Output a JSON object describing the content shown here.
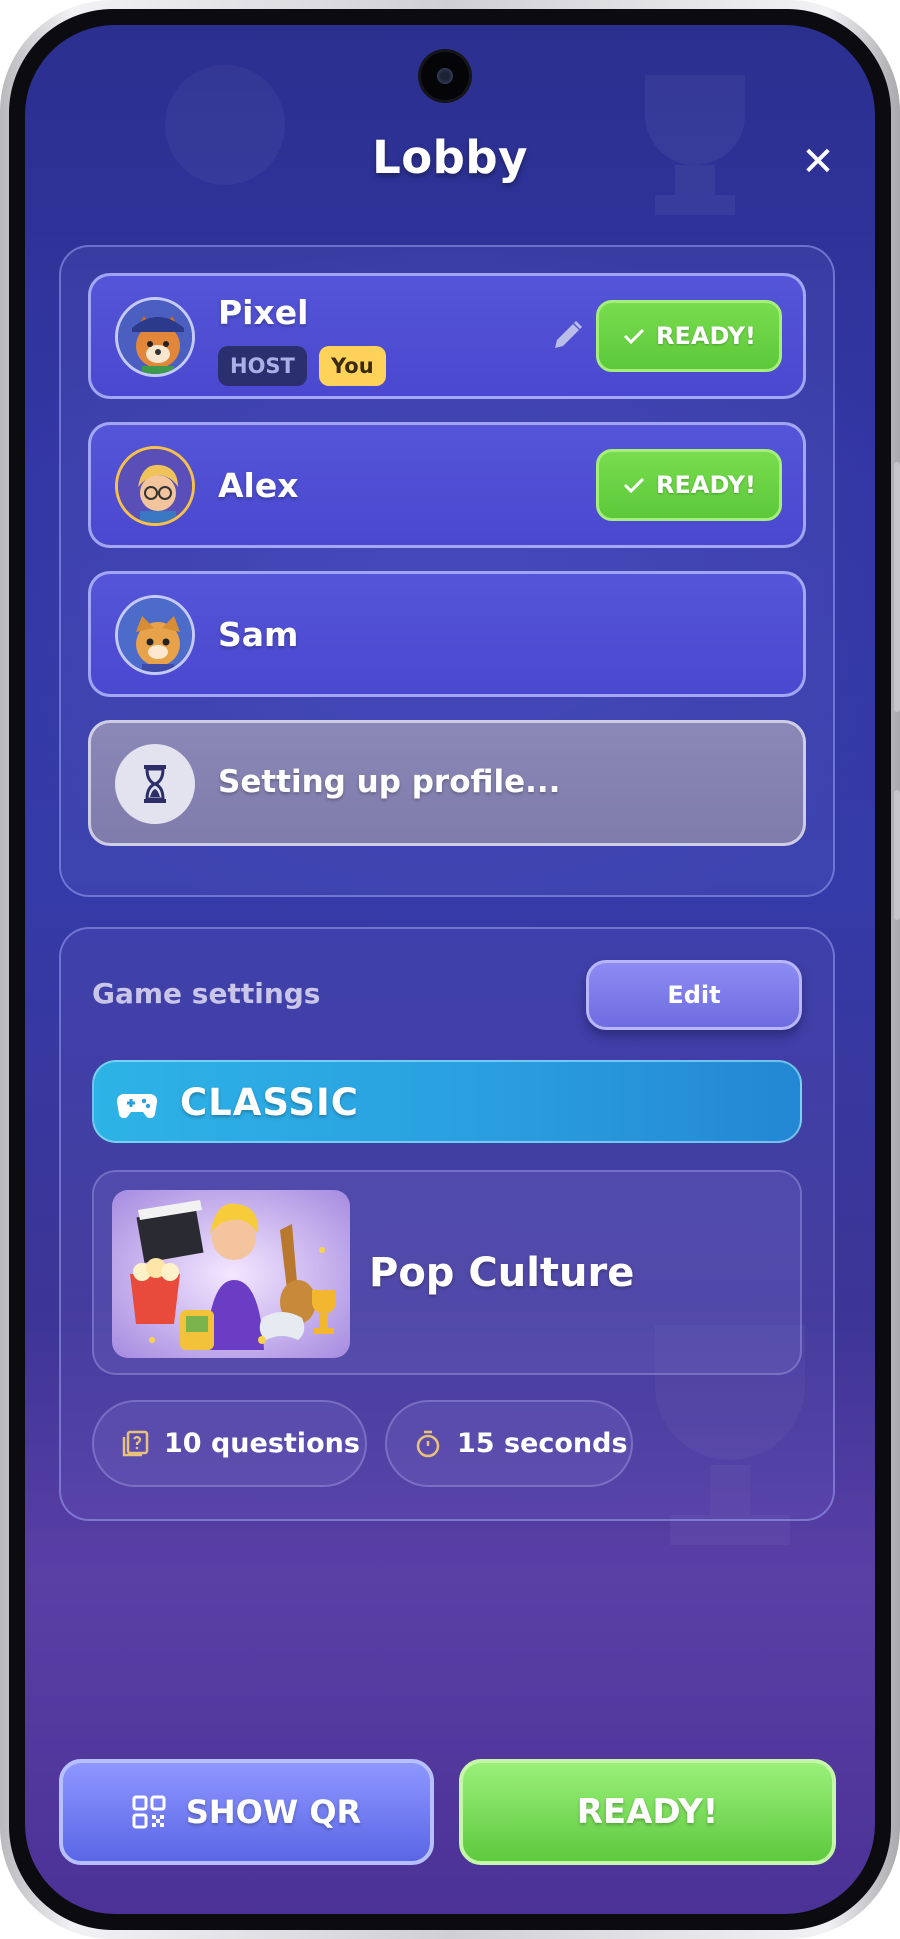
{
  "header": {
    "title": "Lobby",
    "close_icon": "close-icon"
  },
  "players": [
    {
      "name": "Pixel",
      "avatar": "dog-avatar",
      "badges": {
        "host": "HOST",
        "you": "You"
      },
      "status": "READY!",
      "editable": true
    },
    {
      "name": "Alex",
      "avatar": "boy-with-glasses-avatar",
      "status": "READY!"
    },
    {
      "name": "Sam",
      "avatar": "cat-avatar",
      "status": ""
    },
    {
      "name": "Setting up profile...",
      "avatar": "hourglass-icon",
      "status": ""
    }
  ],
  "settings": {
    "label": "Game settings",
    "edit_label": "Edit",
    "mode": "CLASSIC",
    "mode_icon": "gamepad-icon",
    "category": "Pop Culture",
    "questions": "10 questions",
    "time": "15 seconds"
  },
  "actions": {
    "show_qr": "SHOW QR",
    "ready": "READY!"
  },
  "colors": {
    "ready_green": "#5ec93e",
    "accent_blue": "#2a9fe0",
    "card_purple": "#4a48cf",
    "you_badge": "#ffd25a"
  }
}
